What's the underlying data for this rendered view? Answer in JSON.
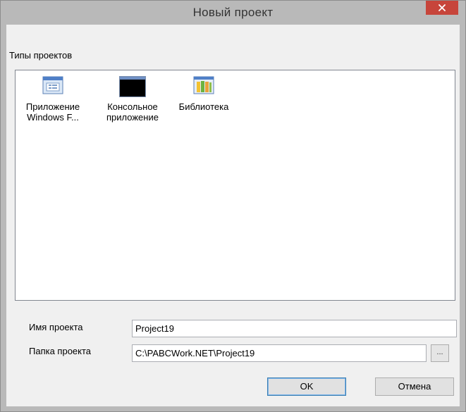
{
  "window": {
    "title": "Новый проект"
  },
  "project_types": {
    "label": "Типы проектов",
    "items": [
      {
        "label": "Приложение\nWindows F...",
        "icon": "windows-forms-icon"
      },
      {
        "label": "Консольное\nприложение",
        "icon": "console-icon"
      },
      {
        "label": "Библиотека",
        "icon": "library-icon"
      }
    ]
  },
  "fields": {
    "name_label": "Имя проекта",
    "name_value": "Project19",
    "folder_label": "Папка проекта",
    "folder_value": "C:\\PABCWork.NET\\Project19",
    "browse_label": "..."
  },
  "buttons": {
    "ok": "OK",
    "cancel": "Отмена"
  },
  "colors": {
    "close_button": "#c7453b",
    "frame": "#b9b9b9",
    "client": "#f0f0f0"
  }
}
